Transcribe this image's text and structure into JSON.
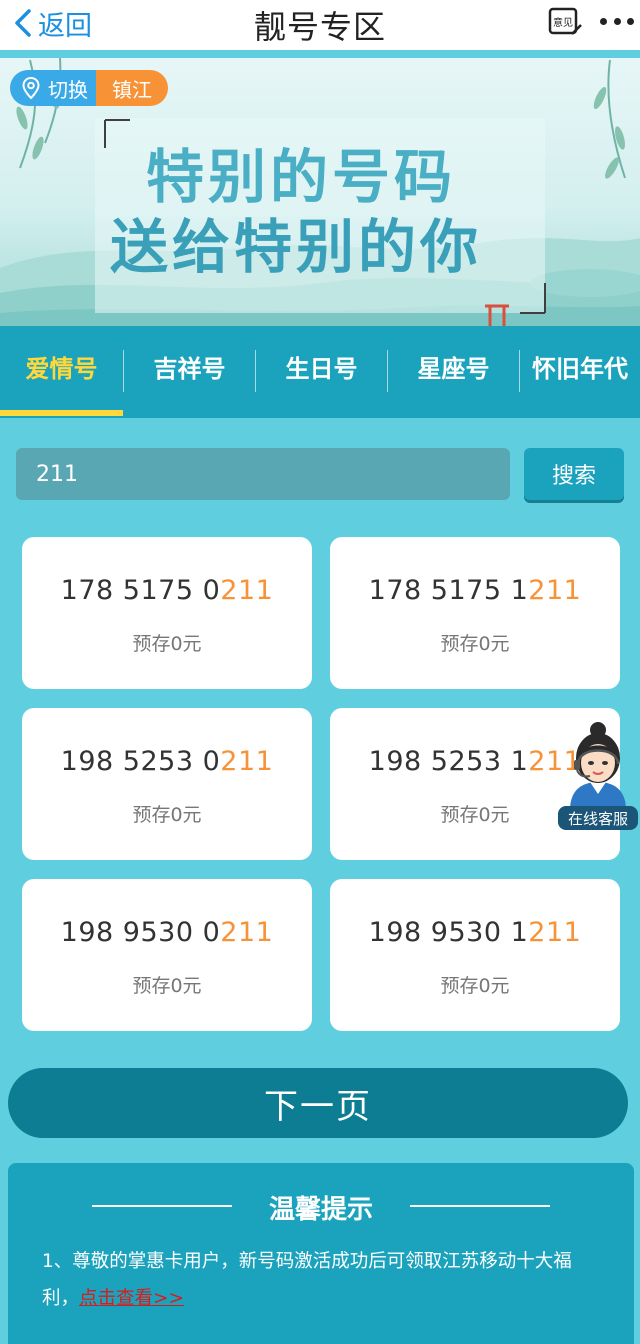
{
  "nav": {
    "back_label": "返回",
    "title": "靓号专区",
    "feedback_label": "意见"
  },
  "banner": {
    "switch_label": "切换",
    "city": "镇江",
    "slogan_line1": "特别的号码",
    "slogan_line2": "送给特别的你"
  },
  "tabs": [
    {
      "label": "爱情号",
      "active": true
    },
    {
      "label": "吉祥号",
      "active": false
    },
    {
      "label": "生日号",
      "active": false
    },
    {
      "label": "星座号",
      "active": false
    },
    {
      "label": "怀旧年代",
      "active": false
    }
  ],
  "search": {
    "value": "211",
    "button_label": "搜索"
  },
  "numbers": [
    {
      "prefix": "178 5175 0",
      "highlight": "211",
      "deposit": "预存0元"
    },
    {
      "prefix": "178 5175 1",
      "highlight": "211",
      "deposit": "预存0元"
    },
    {
      "prefix": "198 5253 0",
      "highlight": "211",
      "deposit": "预存0元"
    },
    {
      "prefix": "198 5253 1",
      "highlight": "211",
      "deposit": "预存0元"
    },
    {
      "prefix": "198 9530 0",
      "highlight": "211",
      "deposit": "预存0元"
    },
    {
      "prefix": "198 9530 1",
      "highlight": "211",
      "deposit": "预存0元"
    }
  ],
  "customer_service": {
    "label": "在线客服"
  },
  "pager": {
    "next_label": "下一页"
  },
  "tip": {
    "title": "温馨提示",
    "text": "1、尊敬的掌惠卡用户，新号码激活成功后可领取江苏移动十大福利，",
    "link_label": "点击查看>>"
  },
  "colors": {
    "accent": "#1ba3bd",
    "highlight": "#f79236",
    "active_tab": "#ffd93b",
    "link": "#d61d1d"
  }
}
